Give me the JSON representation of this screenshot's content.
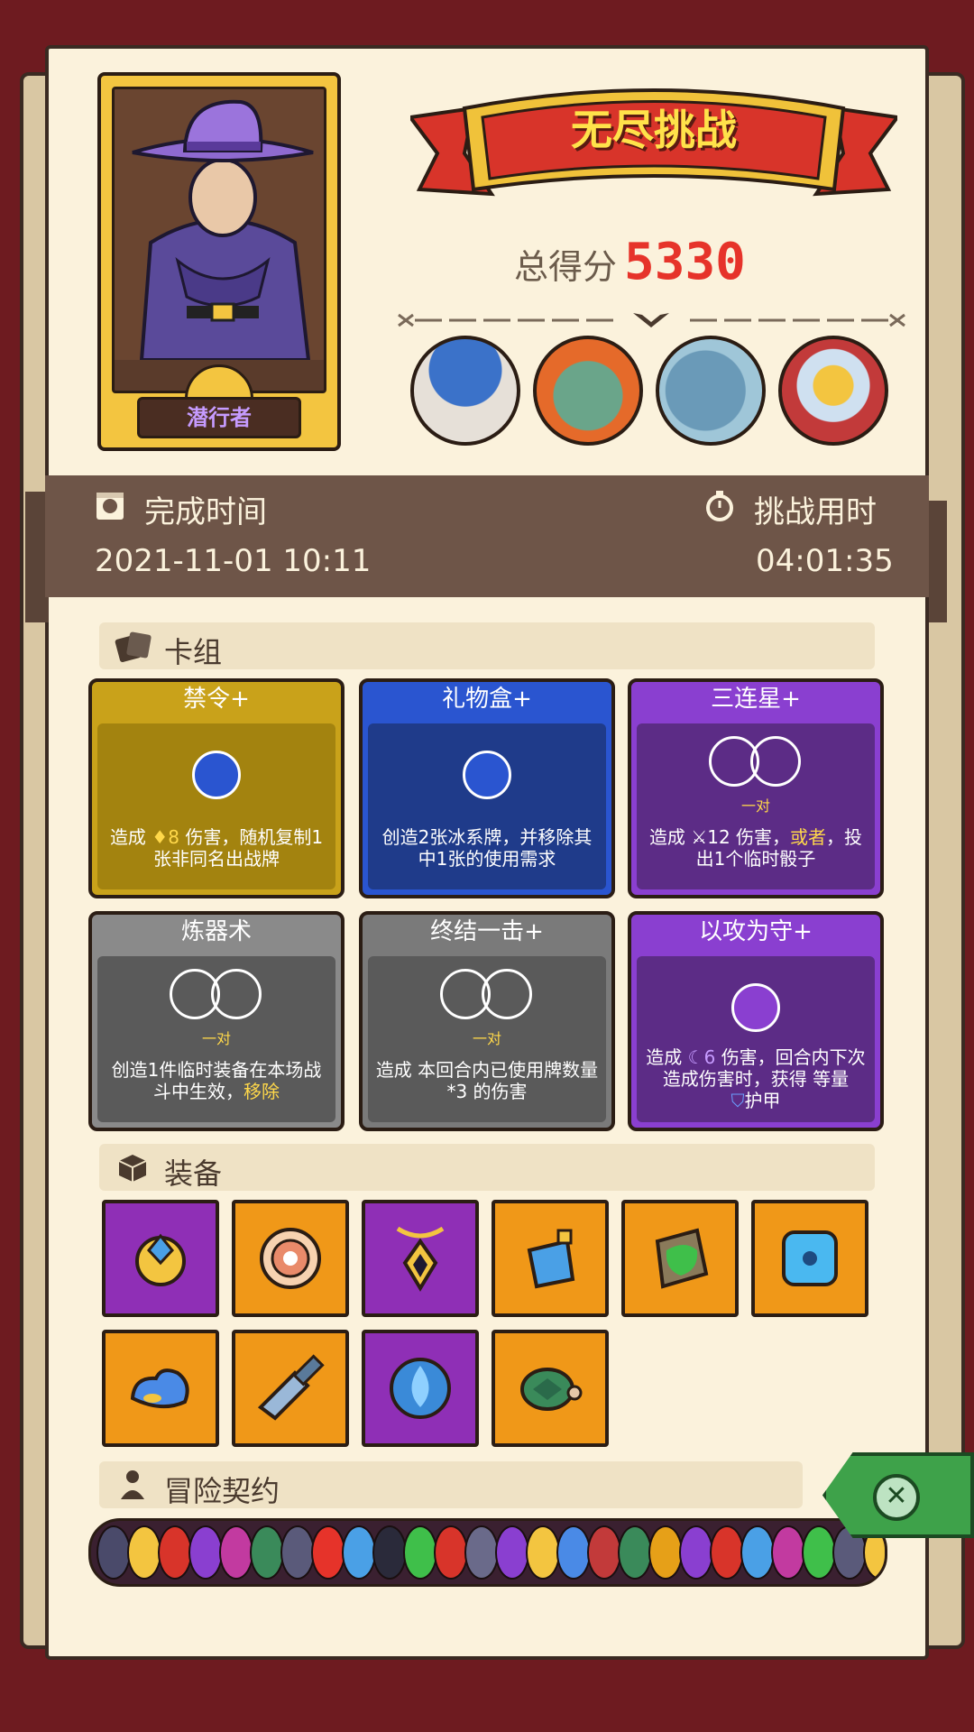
{
  "hero": {
    "name": "潜行者"
  },
  "header": {
    "title": "无尽挑战",
    "score_label": "总得分",
    "score_value": "5330"
  },
  "times": {
    "finish_label": "完成时间",
    "finish_value": "2021-11-01 10:11",
    "duration_label": "挑战用时",
    "duration_value": "04:01:35"
  },
  "deck": {
    "section_title": "卡组",
    "cards": [
      {
        "name": "禁令+",
        "desc_pre": "造成",
        "desc_num": "8",
        "desc_post": "伤害，随机复制1张非同名出战牌",
        "color": "#a3830f",
        "head": "#c9a21a"
      },
      {
        "name": "礼物盒+",
        "desc": "创造2张冰系牌，并移除其中1张的使用需求",
        "color": "#1f3b8a",
        "head": "#2a55d0"
      },
      {
        "name": "三连星+",
        "pair": "一对",
        "desc_pre": "造成",
        "desc_num": "12",
        "desc_mid": "伤害，",
        "desc_hl": "或者",
        "desc_post": "，投出1个临时骰子",
        "color": "#5c2c86",
        "head": "#8a3fd0"
      },
      {
        "name": "炼器术",
        "pair": "一对",
        "desc_pre": "创造1件临时装备在本场战斗中生效，",
        "desc_hl": "移除",
        "color": "#5a5a5a",
        "head": "#8a8a8a"
      },
      {
        "name": "终结一击+",
        "pair": "一对",
        "desc": "造成 本回合内已使用牌数量*3 的伤害",
        "color": "#5a5a5a",
        "head": "#7a7a7a"
      },
      {
        "name": "以攻为守+",
        "desc_pre": "造成",
        "desc_num": "6",
        "desc_post": "伤害，回合内下次造成伤害时，获得 等量",
        "desc_tail": "护甲",
        "color": "#5c2c86",
        "head": "#8a3fd0"
      }
    ]
  },
  "equipment": {
    "section_title": "装备",
    "items": [
      {
        "name": "ring-icon",
        "bg": "purple"
      },
      {
        "name": "shield-disc-icon",
        "bg": "orange"
      },
      {
        "name": "amulet-icon",
        "bg": "purple"
      },
      {
        "name": "crystal-bottle-icon",
        "bg": "orange"
      },
      {
        "name": "moss-stone-icon",
        "bg": "orange"
      },
      {
        "name": "ice-dice-icon",
        "bg": "orange"
      },
      {
        "name": "blue-slime-icon",
        "bg": "orange"
      },
      {
        "name": "broken-blade-icon",
        "bg": "orange"
      },
      {
        "name": "water-drop-icon",
        "bg": "purple"
      },
      {
        "name": "turtle-shell-icon",
        "bg": "orange"
      }
    ]
  },
  "contract": {
    "section_title": "冒险契约"
  },
  "colors": {
    "score": "#e6332a",
    "accent_yellow": "#ffd84a"
  }
}
